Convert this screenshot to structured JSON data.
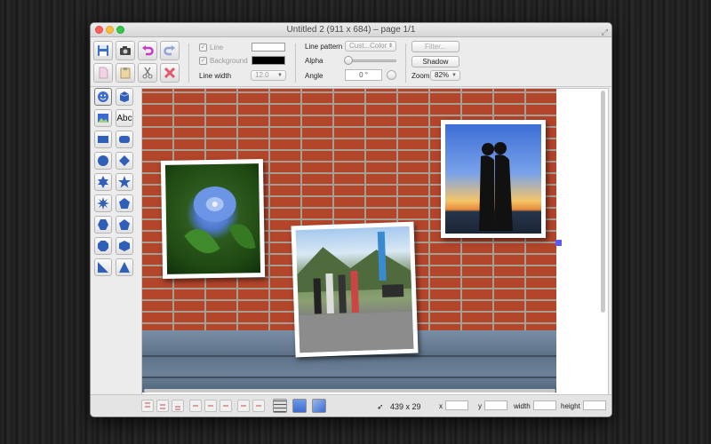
{
  "window": {
    "title": "Untitled 2 (911 x 684) – page 1/1"
  },
  "toolbar": {
    "line_label": "Line",
    "line_checked": true,
    "line_color": "#ffffff",
    "background_label": "Background",
    "background_checked": true,
    "background_color": "#000000",
    "line_width_label": "Line width",
    "line_width_value": "12.0",
    "line_pattern_label": "Line pattern",
    "line_pattern_value": "Cust...Color",
    "alpha_label": "Alpha",
    "angle_label": "Angle",
    "angle_value": "0 °",
    "filter_label": "Filter...",
    "shadow_label": "Shadow",
    "zoom_label": "Zoom",
    "zoom_value": "82%",
    "file_icons": [
      "save-icon",
      "camera-icon",
      "undo-icon",
      "redo-icon",
      "new-document-icon",
      "paste-icon",
      "cut-icon",
      "delete-icon"
    ]
  },
  "shapes_panel": {
    "text_tool_label": "Abc",
    "tools": [
      "smiley-icon",
      "box-3d-icon",
      "image-icon",
      "text-icon",
      "rectangle-icon",
      "rounded-rectangle-icon",
      "circle-icon",
      "diamond-icon",
      "star-6-icon",
      "star-5-icon",
      "star-8-icon",
      "pentagon-icon",
      "hexagon-icon",
      "pentagon-alt-icon",
      "octagon-icon",
      "hexagon-alt-icon",
      "right-triangle-icon",
      "triangle-icon"
    ]
  },
  "canvas": {
    "photos": [
      "flower-photo",
      "kissing-couple-sunset-photo",
      "group-mountain-photo"
    ]
  },
  "statusbar": {
    "cursor_position": "439 x 29",
    "x_label": "x",
    "y_label": "y",
    "width_label": "width",
    "height_label": "height",
    "x_value": "",
    "y_value": "",
    "width_value": "",
    "height_value": ""
  }
}
